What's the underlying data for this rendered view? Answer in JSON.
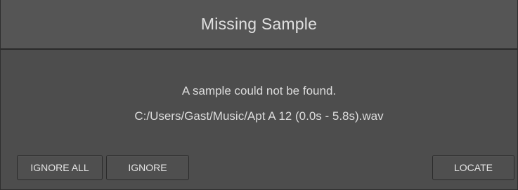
{
  "dialog": {
    "title": "Missing Sample",
    "message": "A sample could not be found.",
    "path": "C:/Users/Gast/Music/Apt A 12 (0.0s - 5.8s).wav"
  },
  "buttons": {
    "ignore_all": "IGNORE ALL",
    "ignore": "IGNORE",
    "locate": "LOCATE"
  },
  "colors": {
    "background": "#4d4d4d",
    "title_bar": "#555555",
    "text": "#e0e0e0"
  }
}
